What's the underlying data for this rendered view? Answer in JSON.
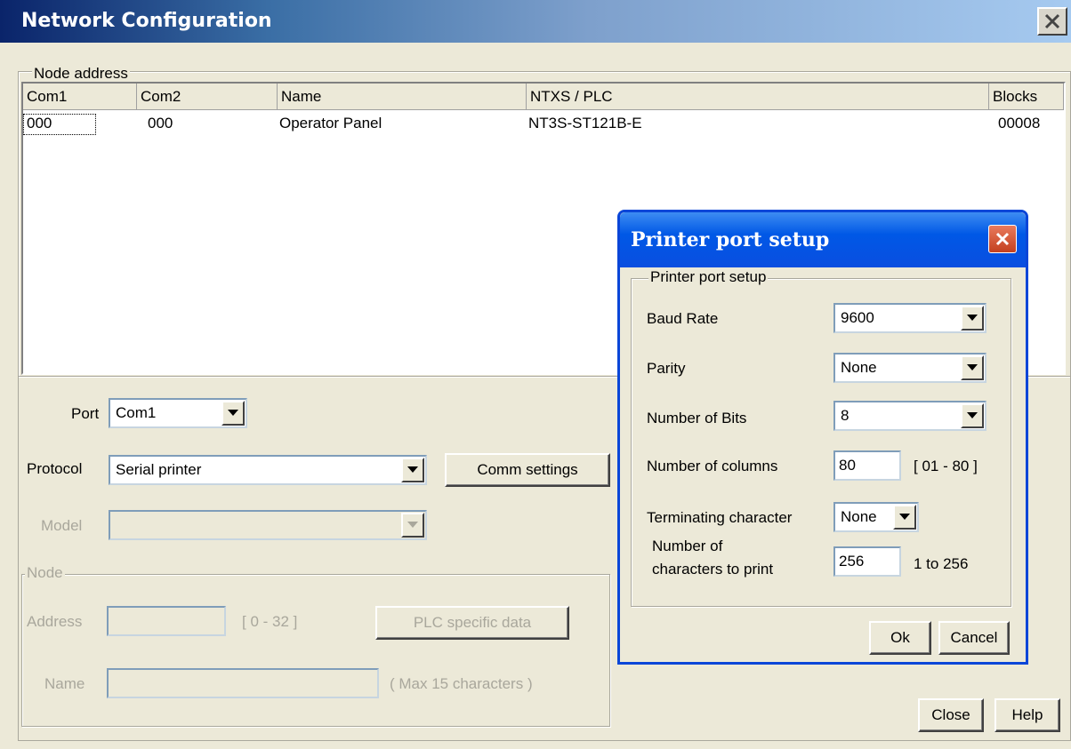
{
  "main_window": {
    "title": "Network Configuration",
    "node_address_legend": "Node address",
    "columns": [
      "Com1",
      "Com2",
      "Name",
      "NTXS / PLC",
      "Blocks"
    ],
    "rows": [
      {
        "com1": "000",
        "com2": "000",
        "name": "Operator Panel",
        "plc": "NT3S-ST121B-E",
        "blocks": "00008"
      }
    ],
    "port_label": "Port",
    "port_value": "Com1",
    "protocol_label": "Protocol",
    "protocol_value": "Serial printer",
    "comm_settings_label": "Comm settings",
    "model_label": "Model",
    "model_value": "",
    "node_legend": "Node",
    "address_label": "Address",
    "address_value": "",
    "address_range": "[ 0 - 32 ]",
    "plc_specific_label": "PLC specific data",
    "name_label": "Name",
    "name_value": "",
    "name_hint": "( Max 15 characters )",
    "close_label": "Close",
    "help_label": "Help"
  },
  "printer_dialog": {
    "title": "Printer port setup",
    "group_legend": "Printer port setup",
    "baud_rate_label": "Baud Rate",
    "baud_rate_value": "9600",
    "parity_label": "Parity",
    "parity_value": "None",
    "bits_label": "Number of Bits",
    "bits_value": "8",
    "columns_label": "Number of columns",
    "columns_value": "80",
    "columns_range": "[ 01 - 80 ]",
    "terminating_label": "Terminating character",
    "terminating_value": "None",
    "chars_label_line1": "Number of",
    "chars_label_line2": "characters to print",
    "chars_value": "256",
    "chars_range": "1 to 256",
    "ok_label": "Ok",
    "cancel_label": "Cancel"
  },
  "colors": {
    "title_bar_start": "#0a246a",
    "title_bar_end": "#a6caf0",
    "dialog_title": "#0058e6",
    "window_bg": "#ece9d8",
    "disabled_text": "#a9a79c"
  },
  "icons": {
    "close": "close-icon",
    "dropdown": "chevron-down-icon"
  }
}
